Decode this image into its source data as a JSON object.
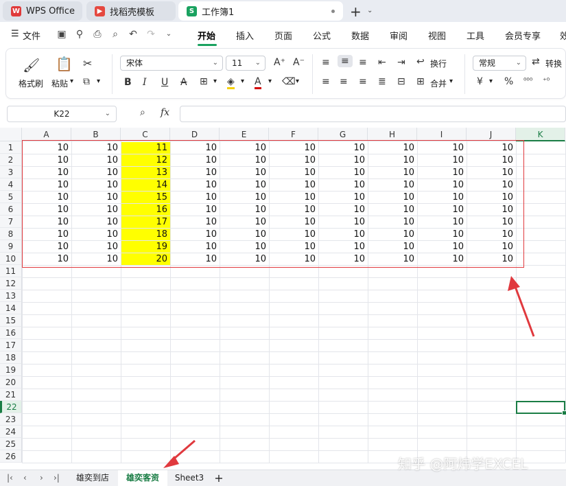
{
  "tabs": [
    {
      "label": "WPS Office",
      "icon": "wps-logo-icon"
    },
    {
      "label": "找稻壳模板",
      "icon": "docer-icon"
    },
    {
      "label": "工作簿1",
      "icon": "spreadsheet-icon"
    }
  ],
  "menu": {
    "file": "文件",
    "items": [
      "开始",
      "插入",
      "页面",
      "公式",
      "数据",
      "审阅",
      "视图",
      "工具",
      "会员专享",
      "效"
    ],
    "active": "开始"
  },
  "ribbon": {
    "format_painter": "格式刷",
    "paste": "粘贴",
    "font_name": "宋体",
    "font_size": "11",
    "wrap": "换行",
    "merge": "合并",
    "number_format": "常规",
    "convert": "转换"
  },
  "formula_bar": {
    "name_box": "K22",
    "fx": "fx",
    "value": ""
  },
  "grid": {
    "columns": [
      "A",
      "B",
      "C",
      "D",
      "E",
      "F",
      "G",
      "H",
      "I",
      "J",
      "K"
    ],
    "rows": [
      "1",
      "2",
      "3",
      "4",
      "5",
      "6",
      "7",
      "8",
      "9",
      "10",
      "11",
      "12",
      "13",
      "14",
      "15",
      "16",
      "17",
      "18",
      "19",
      "20",
      "21",
      "22",
      "23",
      "24",
      "25",
      "26"
    ],
    "data": [
      [
        "10",
        "10",
        "11",
        "10",
        "10",
        "10",
        "10",
        "10",
        "10",
        "10"
      ],
      [
        "10",
        "10",
        "12",
        "10",
        "10",
        "10",
        "10",
        "10",
        "10",
        "10"
      ],
      [
        "10",
        "10",
        "13",
        "10",
        "10",
        "10",
        "10",
        "10",
        "10",
        "10"
      ],
      [
        "10",
        "10",
        "14",
        "10",
        "10",
        "10",
        "10",
        "10",
        "10",
        "10"
      ],
      [
        "10",
        "10",
        "15",
        "10",
        "10",
        "10",
        "10",
        "10",
        "10",
        "10"
      ],
      [
        "10",
        "10",
        "16",
        "10",
        "10",
        "10",
        "10",
        "10",
        "10",
        "10"
      ],
      [
        "10",
        "10",
        "17",
        "10",
        "10",
        "10",
        "10",
        "10",
        "10",
        "10"
      ],
      [
        "10",
        "10",
        "18",
        "10",
        "10",
        "10",
        "10",
        "10",
        "10",
        "10"
      ],
      [
        "10",
        "10",
        "19",
        "10",
        "10",
        "10",
        "10",
        "10",
        "10",
        "10"
      ],
      [
        "10",
        "10",
        "20",
        "10",
        "10",
        "10",
        "10",
        "10",
        "10",
        "10"
      ]
    ],
    "highlight_color": "#ffff00",
    "active_cell": "K22"
  },
  "sheets": {
    "tabs": [
      "雄奕到店",
      "雄奕客资",
      "Sheet3"
    ],
    "active": "雄奕客资",
    "add": "+"
  },
  "watermark": "知乎 @阿炜学EXCEL",
  "colors": {
    "accent": "#1aa260",
    "annotation": "#e0393e"
  }
}
